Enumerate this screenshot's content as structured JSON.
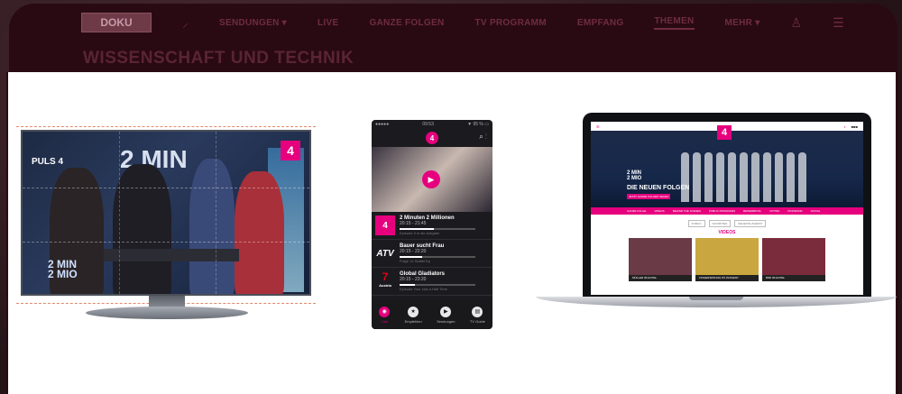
{
  "site": {
    "logo": "DOKU",
    "nav": [
      "SENDUNGEN ▾",
      "LIVE",
      "GANZE FOLGEN",
      "TV PROGRAMM",
      "EMPFANG",
      "THEMEN",
      "MEHR ▾"
    ],
    "active_nav": "THEMEN",
    "page_heading": "WISSENSCHAFT UND TECHNIK"
  },
  "tv": {
    "channel_label": "PULS 4",
    "show_title": "2 MIN",
    "show_logo": "2 MIN\n2 MIO",
    "badge": "4"
  },
  "phone": {
    "status_left": "●●●●● ",
    "status_time": "09:53",
    "status_right": "▼ 95 % ▭",
    "app_badge": "4",
    "list": [
      {
        "logo": "4",
        "logo_color": "#e6007e",
        "title": "2 Minuten 2 Millionen",
        "time": "20:15 - 21:45",
        "progress": 0.45,
        "sub": "Episode 9 in die Aufgabe"
      },
      {
        "logo": "ATV",
        "logo_color": "#1b1b1f",
        "title": "Bauer sucht Frau",
        "time": "20:15 - 22:20",
        "progress": 0.3,
        "sub": "Folge 14 Staffel Ep"
      },
      {
        "logo": "7",
        "logo_color": "#e2001a",
        "title": "Global Gladiators",
        "time": "20:15 - 23:20",
        "progress": 0.2,
        "sub": "Episode Your sick a Half Time"
      }
    ],
    "austria_label": "Austria",
    "tabs": [
      "Live",
      "Empfehlen",
      "Sendungen",
      "TV Guide"
    ]
  },
  "laptop": {
    "badge": "4",
    "hero_logo": "2 MIN\n2 MIO",
    "hero_title": "DIE NEUEN FOLGEN",
    "hero_cta": "JETZT GANZE FOLGEN SEHEN",
    "nav": [
      "GANZE FOLGE",
      "VIDEOS",
      "BEHIND THE SCENES",
      "PUBLIC PROGRAMS",
      "BEWERBUNG",
      "VOTING",
      "PINNWAND",
      "SOCIAL"
    ],
    "filters": [
      "PUBLIC",
      "FAVORITEN",
      "NEUESTE ZUERST"
    ],
    "videos_label": "VIDEOS",
    "videos": [
      {
        "caption": "MÜLLER IM HOTEL",
        "color": "#6a3a46"
      },
      {
        "caption": "FINGERSPRUNG PÜ PASSENT",
        "color": "#c9a640"
      },
      {
        "caption": "BIM! IM HOTEL",
        "color": "#7a2c3c"
      }
    ]
  },
  "colors": {
    "accent": "#e6007e",
    "header_bg": "#2a0a12"
  }
}
